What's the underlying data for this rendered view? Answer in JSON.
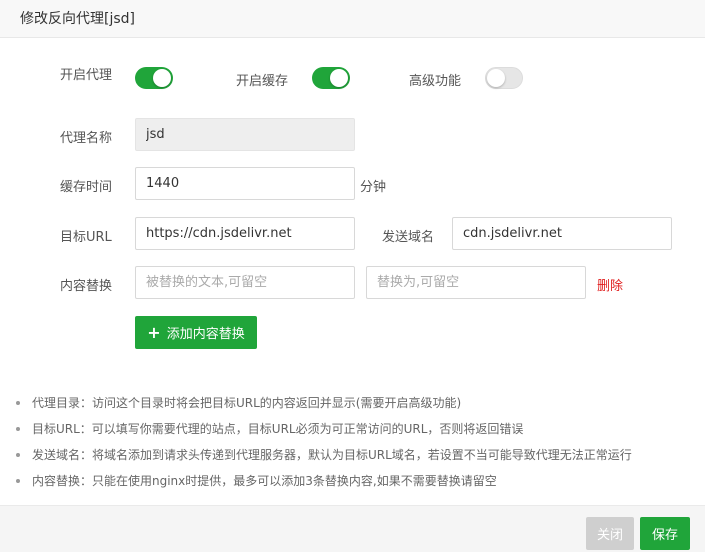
{
  "dialog": {
    "title": "修改反向代理[jsd]"
  },
  "toggles": {
    "enable_proxy": {
      "label": "开启代理",
      "on": true
    },
    "enable_cache": {
      "label": "开启缓存",
      "on": true
    },
    "advanced": {
      "label": "高级功能",
      "on": false
    }
  },
  "fields": {
    "proxy_name": {
      "label": "代理名称",
      "value": "jsd"
    },
    "cache_time": {
      "label": "缓存时间",
      "value": "1440",
      "unit": "分钟"
    },
    "target_url": {
      "label": "目标URL",
      "value": "https://cdn.jsdelivr.net"
    },
    "send_domain": {
      "label": "发送域名",
      "value": "cdn.jsdelivr.net"
    },
    "content_replace": {
      "label": "内容替换",
      "from_placeholder": "被替换的文本,可留空",
      "to_placeholder": "替换为,可留空",
      "delete_label": "删除"
    }
  },
  "add_replace_button": "添加内容替换",
  "tips": [
    "代理目录：访问这个目录时将会把目标URL的内容返回并显示(需要开启高级功能)",
    "目标URL：可以填写你需要代理的站点，目标URL必须为可正常访问的URL，否则将返回错误",
    "发送域名：将域名添加到请求头传递到代理服务器，默认为目标URL域名，若设置不当可能导致代理无法正常运行",
    "内容替换：只能在使用nginx时提供，最多可以添加3条替换内容,如果不需要替换请留空"
  ],
  "footer": {
    "close_label": "关闭",
    "save_label": "保存"
  },
  "colors": {
    "primary": "#20a53a",
    "danger": "#e01d1d",
    "disabled": "#cfcfcf"
  }
}
